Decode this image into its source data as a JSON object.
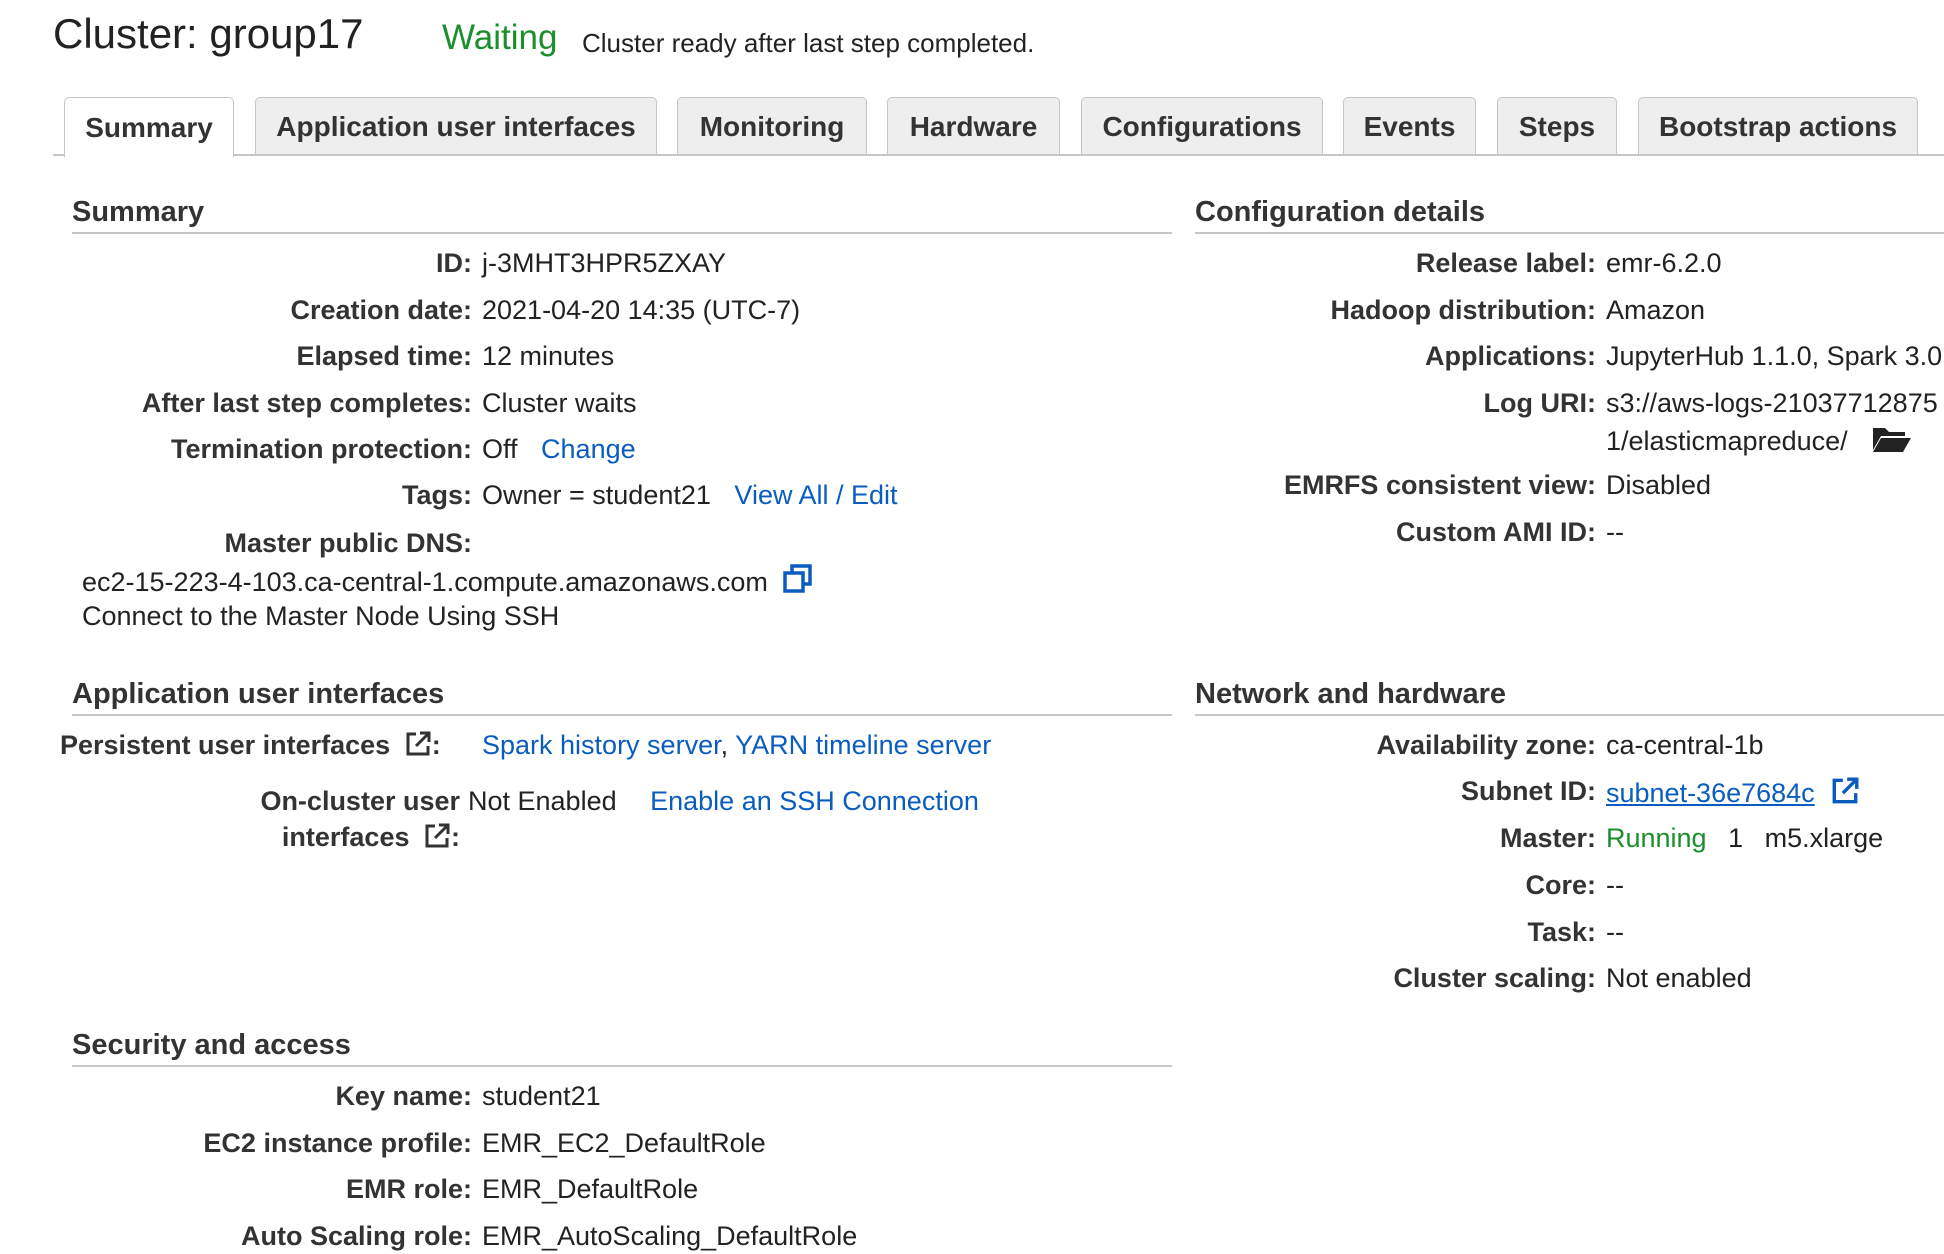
{
  "header": {
    "title": "Cluster: group17",
    "status": "Waiting",
    "status_message": "Cluster ready after last step completed."
  },
  "tabs": [
    {
      "label": "Summary",
      "active": true
    },
    {
      "label": "Application user interfaces"
    },
    {
      "label": "Monitoring"
    },
    {
      "label": "Hardware"
    },
    {
      "label": "Configurations"
    },
    {
      "label": "Events"
    },
    {
      "label": "Steps"
    },
    {
      "label": "Bootstrap actions"
    }
  ],
  "summary": {
    "heading": "Summary",
    "id_label": "ID:",
    "id_value": "j-3MHT3HPR5ZXAY",
    "creation_label": "Creation date:",
    "creation_value": "2021-04-20 14:35 (UTC-7)",
    "elapsed_label": "Elapsed time:",
    "elapsed_value": "12 minutes",
    "after_step_label": "After last step completes:",
    "after_step_value": "Cluster waits",
    "termination_label": "Termination protection:",
    "termination_value": "Off",
    "termination_action": "Change",
    "tags_label": "Tags:",
    "tags_value": "Owner = student21",
    "tags_action": "View All / Edit",
    "dns_label": "Master public DNS:",
    "dns_value": "ec2-15-223-4-103.ca-central-1.compute.amazonaws.com",
    "ssh_link": "Connect to the Master Node Using SSH"
  },
  "configuration": {
    "heading": "Configuration details",
    "release_label": "Release label:",
    "release_value": "emr-6.2.0",
    "hadoop_label": "Hadoop distribution:",
    "hadoop_value": "Amazon",
    "applications_label": "Applications:",
    "applications_value": "JupyterHub 1.1.0, Spark 3.0",
    "log_uri_label": "Log URI:",
    "log_uri_line1": "s3://aws-logs-21037712875",
    "log_uri_line2": "1/elasticmapreduce/",
    "emrfs_label": "EMRFS consistent view:",
    "emrfs_value": "Disabled",
    "ami_label": "Custom AMI ID:",
    "ami_value": "--"
  },
  "app_ui": {
    "heading": "Application user interfaces",
    "persistent_label": "Persistent user interfaces",
    "spark_link": "Spark history server",
    "separator": ",",
    "yarn_link": "YARN timeline server",
    "oncluster_label_line1": "On-cluster user",
    "oncluster_label_line2": "interfaces",
    "colon": ":",
    "oncluster_value": "Not Enabled",
    "oncluster_action": "Enable an SSH Connection"
  },
  "network": {
    "heading": "Network and hardware",
    "az_label": "Availability zone:",
    "az_value": "ca-central-1b",
    "subnet_label": "Subnet ID:",
    "subnet_value": "subnet-36e7684c",
    "master_label": "Master:",
    "master_status": "Running",
    "master_count": "1",
    "master_type": "m5.xlarge",
    "core_label": "Core:",
    "core_value": "--",
    "task_label": "Task:",
    "task_value": "--",
    "scaling_label": "Cluster scaling:",
    "scaling_value": "Not enabled"
  },
  "security": {
    "heading": "Security and access",
    "key_label": "Key name:",
    "key_value": "student21",
    "profile_label": "EC2 instance profile:",
    "profile_value": "EMR_EC2_DefaultRole",
    "emr_role_label": "EMR role:",
    "emr_role_value": "EMR_DefaultRole",
    "autoscale_label": "Auto Scaling role:",
    "autoscale_value": "EMR_AutoScaling_DefaultRole"
  },
  "colors": {
    "link": "#0a5dbf",
    "success": "#1a8f2c",
    "rule": "#c7c7c7"
  }
}
